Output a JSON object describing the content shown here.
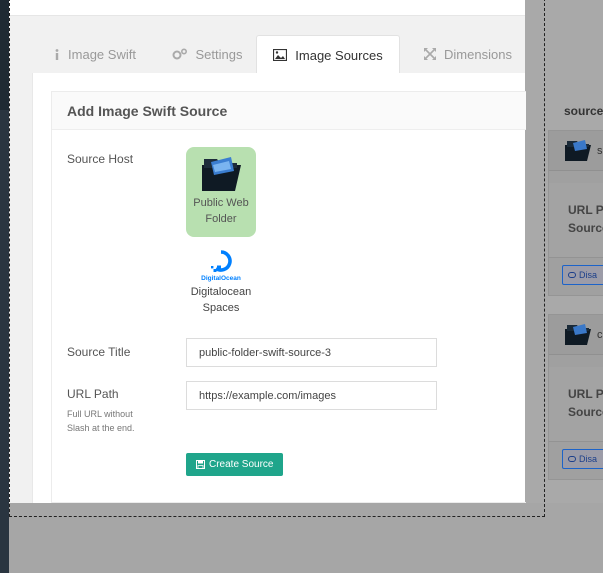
{
  "tabs": [
    {
      "label": "Image Swift",
      "icon": "info-icon"
    },
    {
      "label": "Settings",
      "icon": "cogs-icon"
    },
    {
      "label": "Image Sources",
      "icon": "image-icon",
      "active": true
    },
    {
      "label": "Dimensions",
      "icon": "expand-icon"
    }
  ],
  "form": {
    "heading": "Add Image Swift Source",
    "source_host_label": "Source Host",
    "hosts": [
      {
        "name_line1": "Public Web",
        "name_line2": "Folder",
        "selected": true,
        "icon": "folder-icon"
      },
      {
        "name_line1": "Digitalocean",
        "name_line2": "Spaces",
        "selected": false,
        "icon": "digitalocean-logo",
        "logo_text": "DigitalOcean"
      }
    ],
    "source_title_label": "Source Title",
    "source_title_value": "public-folder-swift-source-3",
    "url_path_label": "URL Path",
    "url_path_hint_line1": "Full URL without",
    "url_path_hint_line2": "Slash at the end.",
    "url_path_value": "https://example.com/images",
    "create_button": "Create Source"
  },
  "sources_panel": {
    "title": "sources",
    "cards": [
      {
        "name": "s",
        "field_line1": "URL P",
        "field_line2": "Source",
        "button": "Disa"
      },
      {
        "name": "c",
        "field_line1": "URL P",
        "field_line2": "Source",
        "button": "Disa"
      }
    ]
  },
  "colors": {
    "accent_green": "#1fa58b",
    "selected_host_bg": "#b8e0b0",
    "disable_button_border": "#1c63c9"
  }
}
